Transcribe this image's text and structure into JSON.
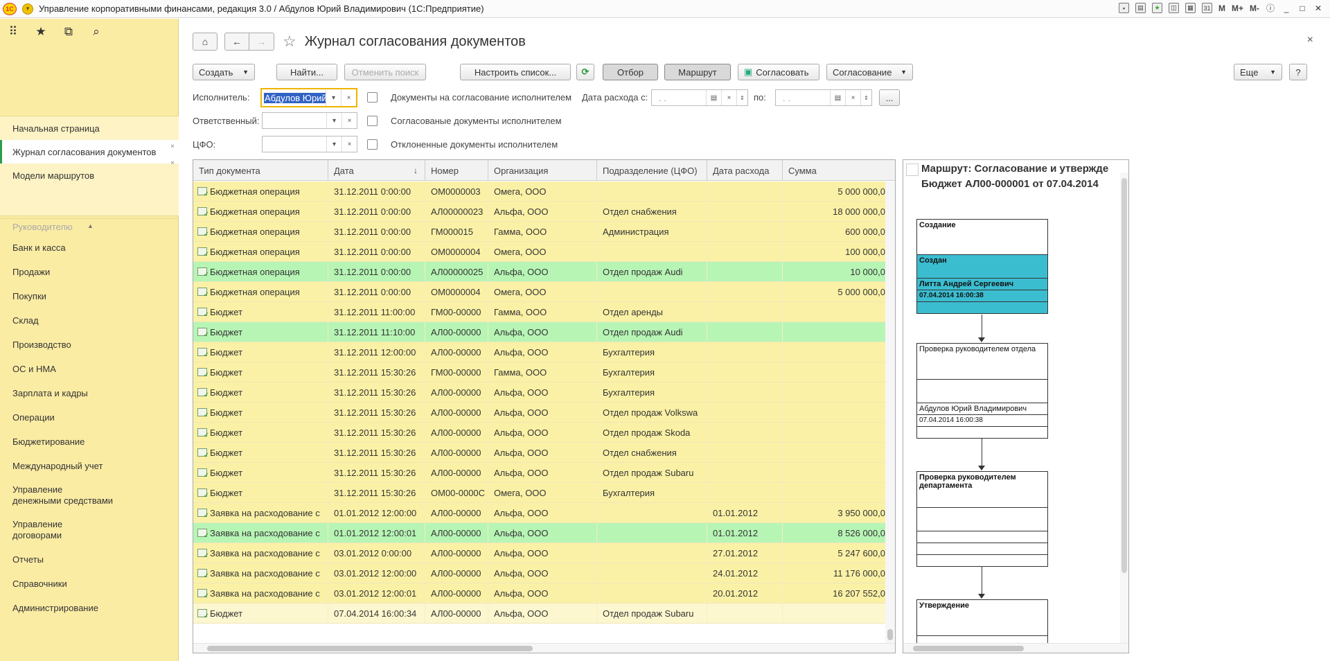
{
  "window": {
    "title": "Управление корпоративными финансами, редакция 3.0 / Абдулов Юрий Владимирович (1С:Предприятие)",
    "logo": "1С",
    "toolbar_icons": [
      "save-icon",
      "print-icon",
      "favorite-icon",
      "history-icon",
      "calculator-icon",
      "calendar-icon"
    ],
    "memory_buttons": [
      "M",
      "M+",
      "M-"
    ]
  },
  "sidebar": {
    "top_icons": [
      "apps-grid-icon",
      "star-icon",
      "history-icon",
      "search-icon"
    ],
    "nav_items": [
      {
        "label": "Начальная страница"
      },
      {
        "label": "Журнал согласования документов",
        "active": true
      },
      {
        "label": "Модели маршрутов"
      }
    ],
    "sections": [
      "Руководителю",
      "Банк и касса",
      "Продажи",
      "Покупки",
      "Склад",
      "Производство",
      "ОС и НМА",
      "Зарплата и кадры",
      "Операции",
      "Бюджетирование",
      "Международный учет",
      "Управление денежными средствами",
      "Управление договорами",
      "Отчеты",
      "Справочники",
      "Администрирование"
    ],
    "sections_two_line": {
      "dm_1": "Управление",
      "dm_2": "денежными средствами",
      "dg_1": "Управление",
      "dg_2": "договорами"
    }
  },
  "page": {
    "title": "Журнал согласования документов",
    "close": "×"
  },
  "toolbar": {
    "create": "Создать",
    "find": "Найти...",
    "cancel_search": "Отменить поиск",
    "configure_list": "Настроить список...",
    "filter": "Отбор",
    "route": "Маршрут",
    "approve": "Согласовать",
    "approval": "Согласование",
    "more": "Еще",
    "help": "?"
  },
  "filters": {
    "executor_label": "Исполнитель:",
    "executor_value": "Абдулов Юрий",
    "responsible_label": "Ответственный:",
    "responsible_value": "",
    "cfo_label": "ЦФО:",
    "cfo_value": "",
    "chk_for_approval": "Документы на согласование исполнителем",
    "chk_approved": "Согласованые документы исполнителем",
    "chk_rejected": "Отклоненные документы исполнителем",
    "date_from_label": "Дата расхода с:",
    "date_from_value": ". .",
    "date_to_label": "по:",
    "date_to_value": ". .",
    "ellipsis": "..."
  },
  "table": {
    "columns": [
      "Тип документа",
      "Дата",
      "Номер",
      "Организация",
      "Подразделение (ЦФО)",
      "Дата расхода",
      "Сумма"
    ],
    "rows": [
      {
        "type": "Бюджетная операция",
        "date": "31.12.2011 0:00:00",
        "num": "ОМ0000003",
        "org": "Омега, ООО",
        "dept": "",
        "exp": "",
        "sum": "5 000 000,0",
        "color": "yellow"
      },
      {
        "type": "Бюджетная операция",
        "date": "31.12.2011 0:00:00",
        "num": "АЛ00000023",
        "org": "Альфа, ООО",
        "dept": "Отдел снабжения",
        "exp": "",
        "sum": "18 000 000,0",
        "color": "yellow"
      },
      {
        "type": "Бюджетная операция",
        "date": "31.12.2011 0:00:00",
        "num": "ГМ000015",
        "org": "Гамма, ООО",
        "dept": "Администрация",
        "exp": "",
        "sum": "600 000,0",
        "color": "yellow"
      },
      {
        "type": "Бюджетная операция",
        "date": "31.12.2011 0:00:00",
        "num": "ОМ0000004",
        "org": "Омега, ООО",
        "dept": "",
        "exp": "",
        "sum": "100 000,0",
        "color": "yellow"
      },
      {
        "type": "Бюджетная операция",
        "date": "31.12.2011 0:00:00",
        "num": "АЛ00000025",
        "org": "Альфа, ООО",
        "dept": "Отдел продаж Audi",
        "exp": "",
        "sum": "10 000,0",
        "color": "green"
      },
      {
        "type": "Бюджетная операция",
        "date": "31.12.2011 0:00:00",
        "num": "ОМ0000004",
        "org": "Омега, ООО",
        "dept": "",
        "exp": "",
        "sum": "5 000 000,0",
        "color": "yellow"
      },
      {
        "type": "Бюджет",
        "date": "31.12.2011 11:00:00",
        "num": "ГМ00-00000",
        "org": "Гамма, ООО",
        "dept": "Отдел аренды",
        "exp": "",
        "sum": "",
        "color": "yellow"
      },
      {
        "type": "Бюджет",
        "date": "31.12.2011 11:10:00",
        "num": "АЛ00-00000",
        "org": "Альфа, ООО",
        "dept": "Отдел продаж Audi",
        "exp": "",
        "sum": "",
        "color": "green"
      },
      {
        "type": "Бюджет",
        "date": "31.12.2011 12:00:00",
        "num": "АЛ00-00000",
        "org": "Альфа, ООО",
        "dept": "Бухгалтерия",
        "exp": "",
        "sum": "",
        "color": "yellow"
      },
      {
        "type": "Бюджет",
        "date": "31.12.2011 15:30:26",
        "num": "ГМ00-00000",
        "org": "Гамма, ООО",
        "dept": "Бухгалтерия",
        "exp": "",
        "sum": "",
        "color": "yellow"
      },
      {
        "type": "Бюджет",
        "date": "31.12.2011 15:30:26",
        "num": "АЛ00-00000",
        "org": "Альфа, ООО",
        "dept": "Бухгалтерия",
        "exp": "",
        "sum": "",
        "color": "yellow"
      },
      {
        "type": "Бюджет",
        "date": "31.12.2011 15:30:26",
        "num": "АЛ00-00000",
        "org": "Альфа, ООО",
        "dept": "Отдел продаж Volkswa",
        "exp": "",
        "sum": "",
        "color": "yellow"
      },
      {
        "type": "Бюджет",
        "date": "31.12.2011 15:30:26",
        "num": "АЛ00-00000",
        "org": "Альфа, ООО",
        "dept": "Отдел продаж Skoda",
        "exp": "",
        "sum": "",
        "color": "yellow"
      },
      {
        "type": "Бюджет",
        "date": "31.12.2011 15:30:26",
        "num": "АЛ00-00000",
        "org": "Альфа, ООО",
        "dept": "Отдел снабжения",
        "exp": "",
        "sum": "",
        "color": "yellow"
      },
      {
        "type": "Бюджет",
        "date": "31.12.2011 15:30:26",
        "num": "АЛ00-00000",
        "org": "Альфа, ООО",
        "dept": "Отдел продаж Subaru",
        "exp": "",
        "sum": "",
        "color": "yellow"
      },
      {
        "type": "Бюджет",
        "date": "31.12.2011 15:30:26",
        "num": "ОМ00-0000С",
        "org": "Омега, ООО",
        "dept": "Бухгалтерия",
        "exp": "",
        "sum": "",
        "color": "yellow"
      },
      {
        "type": "Заявка на расходование с",
        "date": "01.01.2012 12:00:00",
        "num": "АЛ00-00000",
        "org": "Альфа, ООО",
        "dept": "",
        "exp": "01.01.2012",
        "sum": "3 950 000,0",
        "color": "yellow"
      },
      {
        "type": "Заявка на расходование с",
        "date": "01.01.2012 12:00:01",
        "num": "АЛ00-00000",
        "org": "Альфа, ООО",
        "dept": "",
        "exp": "01.01.2012",
        "sum": "8 526 000,0",
        "color": "green"
      },
      {
        "type": "Заявка на расходование с",
        "date": "03.01.2012 0:00:00",
        "num": "АЛ00-00000",
        "org": "Альфа, ООО",
        "dept": "",
        "exp": "27.01.2012",
        "sum": "5 247 600,0",
        "color": "yellow"
      },
      {
        "type": "Заявка на расходование с",
        "date": "03.01.2012 12:00:00",
        "num": "АЛ00-00000",
        "org": "Альфа, ООО",
        "dept": "",
        "exp": "24.01.2012",
        "sum": "11 176 000,0",
        "color": "yellow"
      },
      {
        "type": "Заявка на расходование с",
        "date": "03.01.2012 12:00:01",
        "num": "АЛ00-00000",
        "org": "Альфа, ООО",
        "dept": "",
        "exp": "20.01.2012",
        "sum": "16 207 552,0",
        "color": "yellow"
      },
      {
        "type": "Бюджет",
        "date": "07.04.2014 16:00:34",
        "num": "АЛ00-00000",
        "org": "Альфа, ООО",
        "dept": "Отдел продаж Subaru",
        "exp": "",
        "sum": "",
        "color": "current"
      }
    ]
  },
  "route_panel": {
    "title_line1": "Маршрут: Согласование и утвержде",
    "title_line2": "Бюджет АЛ00-000001 от 07.04.2014",
    "nodes": {
      "n1_title": "Создание",
      "n1_status": "Создан",
      "n1_person": "Литта Андрей Сергеевич",
      "n1_date": "07.04.2014 16:00:38",
      "n2_title": "Проверка руководителем отдела",
      "n2_person": "Абдулов Юрий Владимирович",
      "n2_date": "07.04.2014 16:00:38",
      "n3_title": "Проверка руководителем департамента",
      "n4_title": "Утверждение"
    }
  }
}
